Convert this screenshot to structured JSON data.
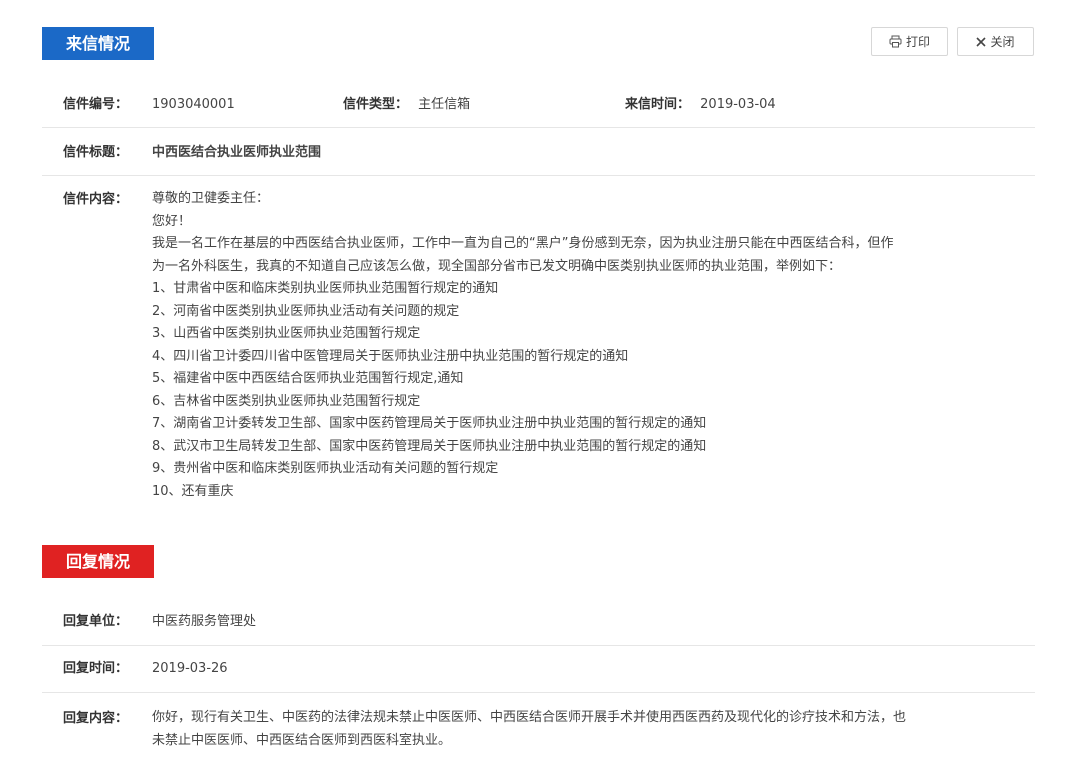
{
  "letter_section": {
    "badge": "来信情况",
    "print_label": "打印",
    "close_label": "关闭",
    "number_label": "信件编号：",
    "number_value": "1903040001",
    "type_label": "信件类型：",
    "type_value": "主任信箱",
    "date_label": "来信时间：",
    "date_value": "2019-03-04",
    "title_label": "信件标题：",
    "title_value": "中西医结合执业医师执业范围",
    "content_label": "信件内容：",
    "content_lines": [
      "尊敬的卫健委主任：",
      "您好！",
      "我是一名工作在基层的中西医结合执业医师，工作中一直为自己的“黑户”身份感到无奈，因为执业注册只能在中西医结合科，但作",
      "为一名外科医生，我真的不知道自己应该怎么做，现全国部分省市已发文明确中医类别执业医师的执业范围，举例如下：",
      "1、甘肃省中医和临床类别执业医师执业范围暂行规定的通知",
      "2、河南省中医类别执业医师执业活动有关问题的规定",
      "3、山西省中医类别执业医师执业范围暂行规定",
      "4、四川省卫计委四川省中医管理局关于医师执业注册中执业范围的暂行规定的通知",
      "5、福建省中医中西医结合医师执业范围暂行规定,通知",
      "6、吉林省中医类别执业医师执业范围暂行规定",
      "7、湖南省卫计委转发卫生部、国家中医药管理局关于医师执业注册中执业范围的暂行规定的通知",
      "8、武汉市卫生局转发卫生部、国家中医药管理局关于医师执业注册中执业范围的暂行规定的通知",
      "9、贵州省中医和临床类别医师执业活动有关问题的暂行规定",
      "10、还有重庆"
    ]
  },
  "reply_section": {
    "badge": "回复情况",
    "unit_label": "回复单位：",
    "unit_value": "中医药服务管理处",
    "date_label": "回复时间：",
    "date_value": "2019-03-26",
    "content_label": "回复内容：",
    "content_lines": [
      "你好，现行有关卫生、中医药的法律法规未禁止中医医师、中西医结合医师开展手术并使用西医西药及现代化的诊疗技术和方法，也",
      "未禁止中医医师、中西医结合医师到西医科室执业。"
    ]
  },
  "colors": {
    "letter_badge": "#1b69c7",
    "reply_badge": "#e02222",
    "title_text": "#d21e1e"
  },
  "icons": {
    "print": "printer-icon",
    "close": "close-icon"
  }
}
